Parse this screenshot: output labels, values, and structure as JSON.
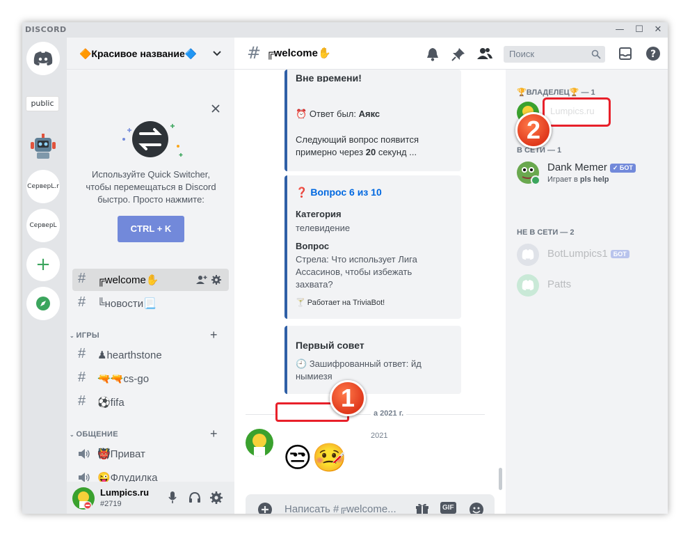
{
  "window": {
    "brand": "DISCORD",
    "minimize": "—",
    "maximize": "☐",
    "close": "✕"
  },
  "rail": {
    "tooltip": "public",
    "servers": [
      "СерверL.r",
      "СерверL"
    ],
    "add": "+"
  },
  "sidebar": {
    "server_name": "🔶Красивое название🔷",
    "quick_switcher": {
      "text": "Используйте Quick Switcher, чтобы перемещаться в Discord быстро. Просто нажмите:",
      "button": "CTRL + K"
    },
    "channels": [
      {
        "label": "╔welcome✋"
      },
      {
        "label": "╚новости📃"
      }
    ],
    "categories": [
      {
        "label": "ИГРЫ",
        "channels": [
          "♟hearthstone",
          "🔫🔫cs-go",
          "⚽fifa"
        ]
      },
      {
        "label": "ОБЩЕНИЕ",
        "channels": [
          "👹Приват",
          "😜Флудилка"
        ]
      }
    ]
  },
  "user": {
    "name": "Lumpics.ru",
    "tag": "#2719"
  },
  "chat": {
    "header_title": "╔welcome✋",
    "search_placeholder": "Поиск",
    "embed1": {
      "title": "Вне времени!",
      "answer_prefix": "Ответ был:",
      "answer": "Аякс",
      "next_text_1": "Следующий вопрос появится",
      "next_text_2": "примерно через",
      "seconds": "20",
      "next_text_3": "секунд ..."
    },
    "embed2": {
      "title": "Вопрос 6 из 10",
      "category_label": "Категория",
      "category_value": "телевидение",
      "question_label": "Вопрос",
      "question_text": "Стрела: Что использует Лига Ассасинов, чтобы избежать захвата?",
      "footer": "Работает на TriviaBot!"
    },
    "embed3": {
      "title": "Первый совет",
      "hint": "Зашифрованный ответ: йд нымиезя"
    },
    "divider_date": "а 2021 г.",
    "message_time": "2021",
    "reactions": "😒🤒",
    "composer_placeholder": "Написать #╔welcome...",
    "gif": "GIF"
  },
  "members": {
    "owner_category": "🏆ВЛАДЕЛЕЦ🏆 — 1",
    "owner_name": "Lumpics.ru",
    "online_category": "В СЕТИ — 1",
    "bot_name": "Dank Memer",
    "bot_badge": "✓ БОТ",
    "bot_status_prefix": "Играет в",
    "bot_status_game": "pls help",
    "offline_category": "НЕ В СЕТИ — 2",
    "offline": [
      {
        "name": "BotLumpics1",
        "badge": "БОТ"
      },
      {
        "name": "Patts"
      }
    ]
  },
  "markers": [
    "1",
    "2"
  ]
}
